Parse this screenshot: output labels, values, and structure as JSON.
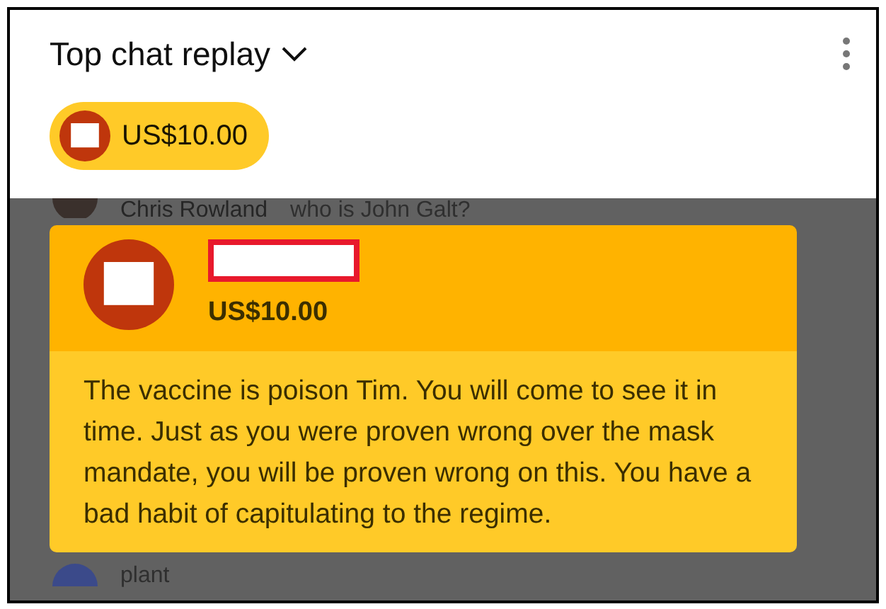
{
  "header": {
    "title": "Top chat replay"
  },
  "ticker": [
    {
      "amount": "US$10.00"
    }
  ],
  "chat_messages": [
    {
      "author": "Chris Rowland",
      "text": "who is John Galt?"
    },
    {
      "text": "plant"
    }
  ],
  "super_chat": {
    "amount": "US$10.00",
    "message": "The vaccine is poison Tim. You will come to see it in time. Just as you were proven wrong over the mask mandate, you will be proven wrong on this. You have a bad habit of capitulating to the regime."
  }
}
